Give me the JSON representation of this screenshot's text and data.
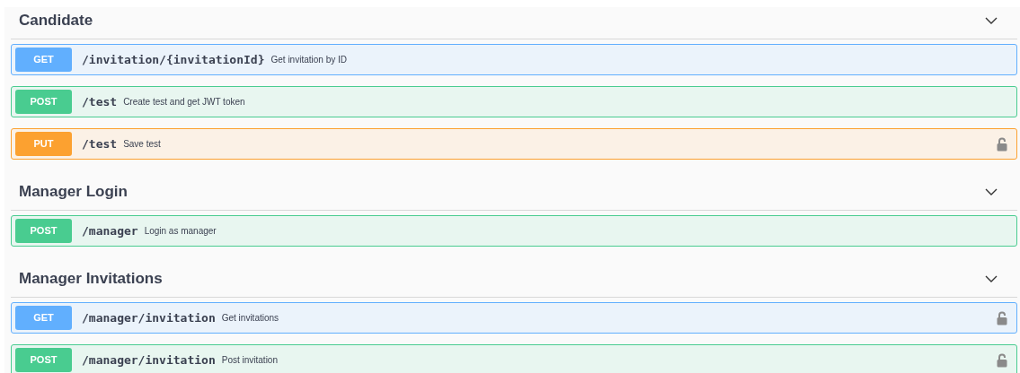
{
  "sections": [
    {
      "title": "Candidate",
      "expanded": true,
      "operations": [
        {
          "method": "GET",
          "path": "/invitation/{invitationId}",
          "summary": "Get invitation by ID",
          "locked": false
        },
        {
          "method": "POST",
          "path": "/test",
          "summary": "Create test and get JWT token",
          "locked": false
        },
        {
          "method": "PUT",
          "path": "/test",
          "summary": "Save test",
          "locked": true
        }
      ]
    },
    {
      "title": "Manager Login",
      "expanded": true,
      "operations": [
        {
          "method": "POST",
          "path": "/manager",
          "summary": "Login as manager",
          "locked": false
        }
      ]
    },
    {
      "title": "Manager Invitations",
      "expanded": true,
      "operations": [
        {
          "method": "GET",
          "path": "/manager/invitation",
          "summary": "Get invitations",
          "locked": true
        },
        {
          "method": "POST",
          "path": "/manager/invitation",
          "summary": "Post invitation",
          "locked": true
        }
      ]
    }
  ]
}
